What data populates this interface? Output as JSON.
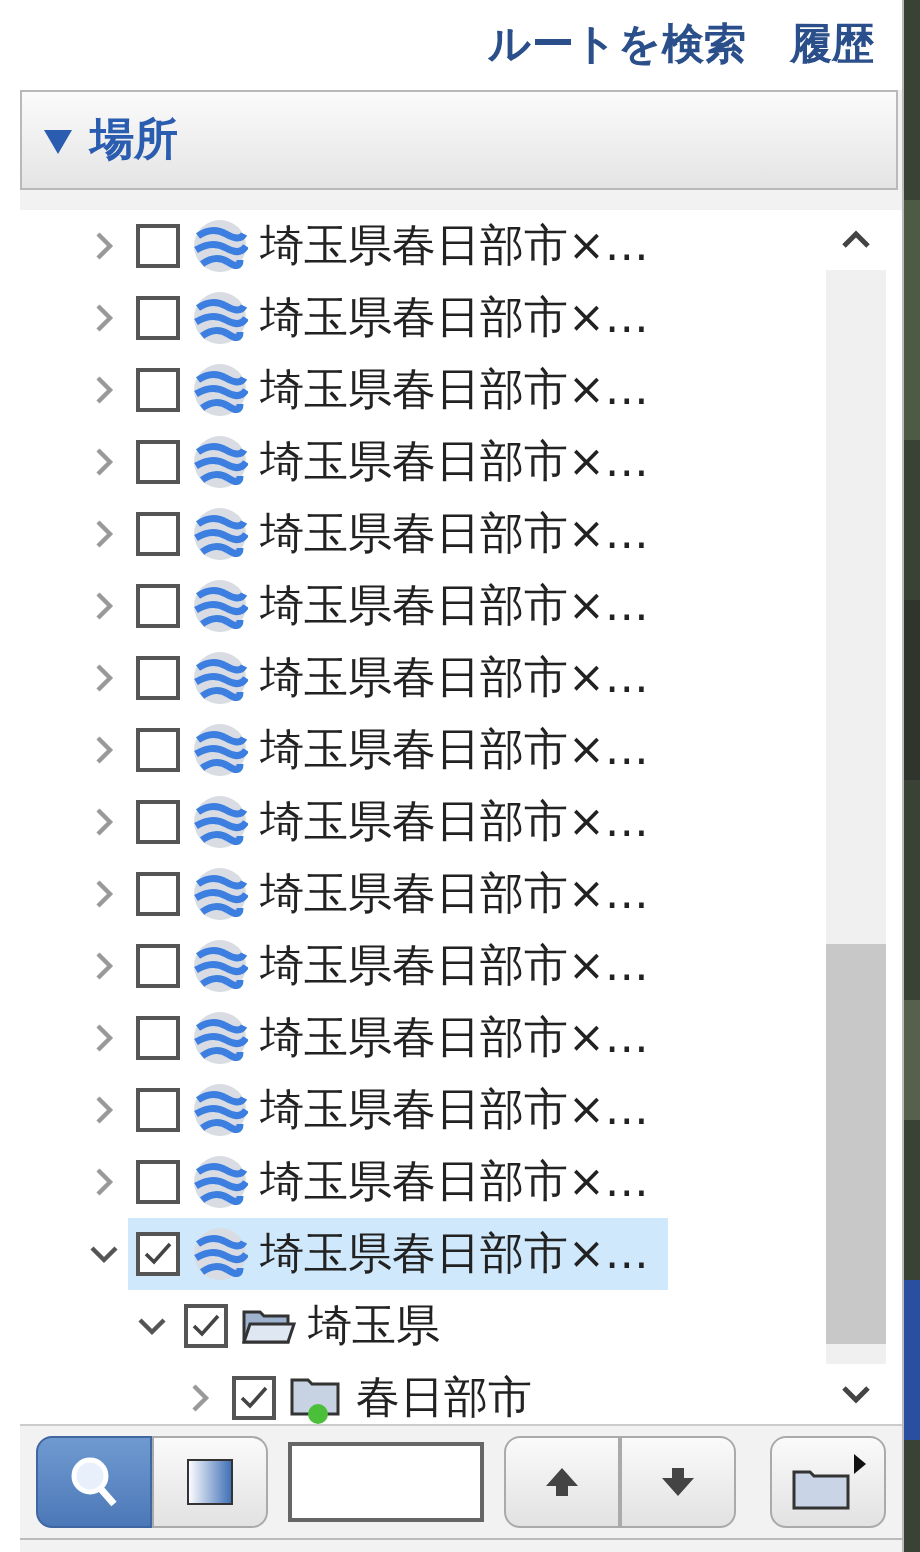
{
  "top_links": [
    {
      "label": "ルートを検索"
    },
    {
      "label": "履歴"
    }
  ],
  "places": {
    "title": "場所",
    "expanded": true,
    "tree": [
      {
        "label": "埼玉県春日部市×…",
        "kind": "globe",
        "checked": false,
        "selected": false,
        "expanded": false
      },
      {
        "label": "埼玉県春日部市×…",
        "kind": "globe",
        "checked": false,
        "selected": false,
        "expanded": false
      },
      {
        "label": "埼玉県春日部市×…",
        "kind": "globe",
        "checked": false,
        "selected": false,
        "expanded": false
      },
      {
        "label": "埼玉県春日部市×…",
        "kind": "globe",
        "checked": false,
        "selected": false,
        "expanded": false
      },
      {
        "label": "埼玉県春日部市×…",
        "kind": "globe",
        "checked": false,
        "selected": false,
        "expanded": false
      },
      {
        "label": "埼玉県春日部市×…",
        "kind": "globe",
        "checked": false,
        "selected": false,
        "expanded": false
      },
      {
        "label": "埼玉県春日部市×…",
        "kind": "globe",
        "checked": false,
        "selected": false,
        "expanded": false
      },
      {
        "label": "埼玉県春日部市×…",
        "kind": "globe",
        "checked": false,
        "selected": false,
        "expanded": false
      },
      {
        "label": "埼玉県春日部市×…",
        "kind": "globe",
        "checked": false,
        "selected": false,
        "expanded": false
      },
      {
        "label": "埼玉県春日部市×…",
        "kind": "globe",
        "checked": false,
        "selected": false,
        "expanded": false
      },
      {
        "label": "埼玉県春日部市×…",
        "kind": "globe",
        "checked": false,
        "selected": false,
        "expanded": false
      },
      {
        "label": "埼玉県春日部市×…",
        "kind": "globe",
        "checked": false,
        "selected": false,
        "expanded": false
      },
      {
        "label": "埼玉県春日部市×…",
        "kind": "globe",
        "checked": false,
        "selected": false,
        "expanded": false
      },
      {
        "label": "埼玉県春日部市×…",
        "kind": "globe",
        "checked": false,
        "selected": false,
        "expanded": false
      },
      {
        "label": "埼玉県春日部市×…",
        "kind": "globe",
        "checked": true,
        "selected": true,
        "expanded": true,
        "children": [
          {
            "label": "埼玉県",
            "kind": "folder",
            "checked": true,
            "selected": false,
            "expanded": true,
            "children": [
              {
                "label": "春日部市",
                "kind": "place-folder",
                "checked": true,
                "selected": false,
                "expanded": false
              }
            ]
          }
        ]
      }
    ]
  },
  "toolbar": {
    "toggles": [
      {
        "kind": "search",
        "selected": true
      },
      {
        "kind": "panel",
        "selected": false
      }
    ]
  }
}
